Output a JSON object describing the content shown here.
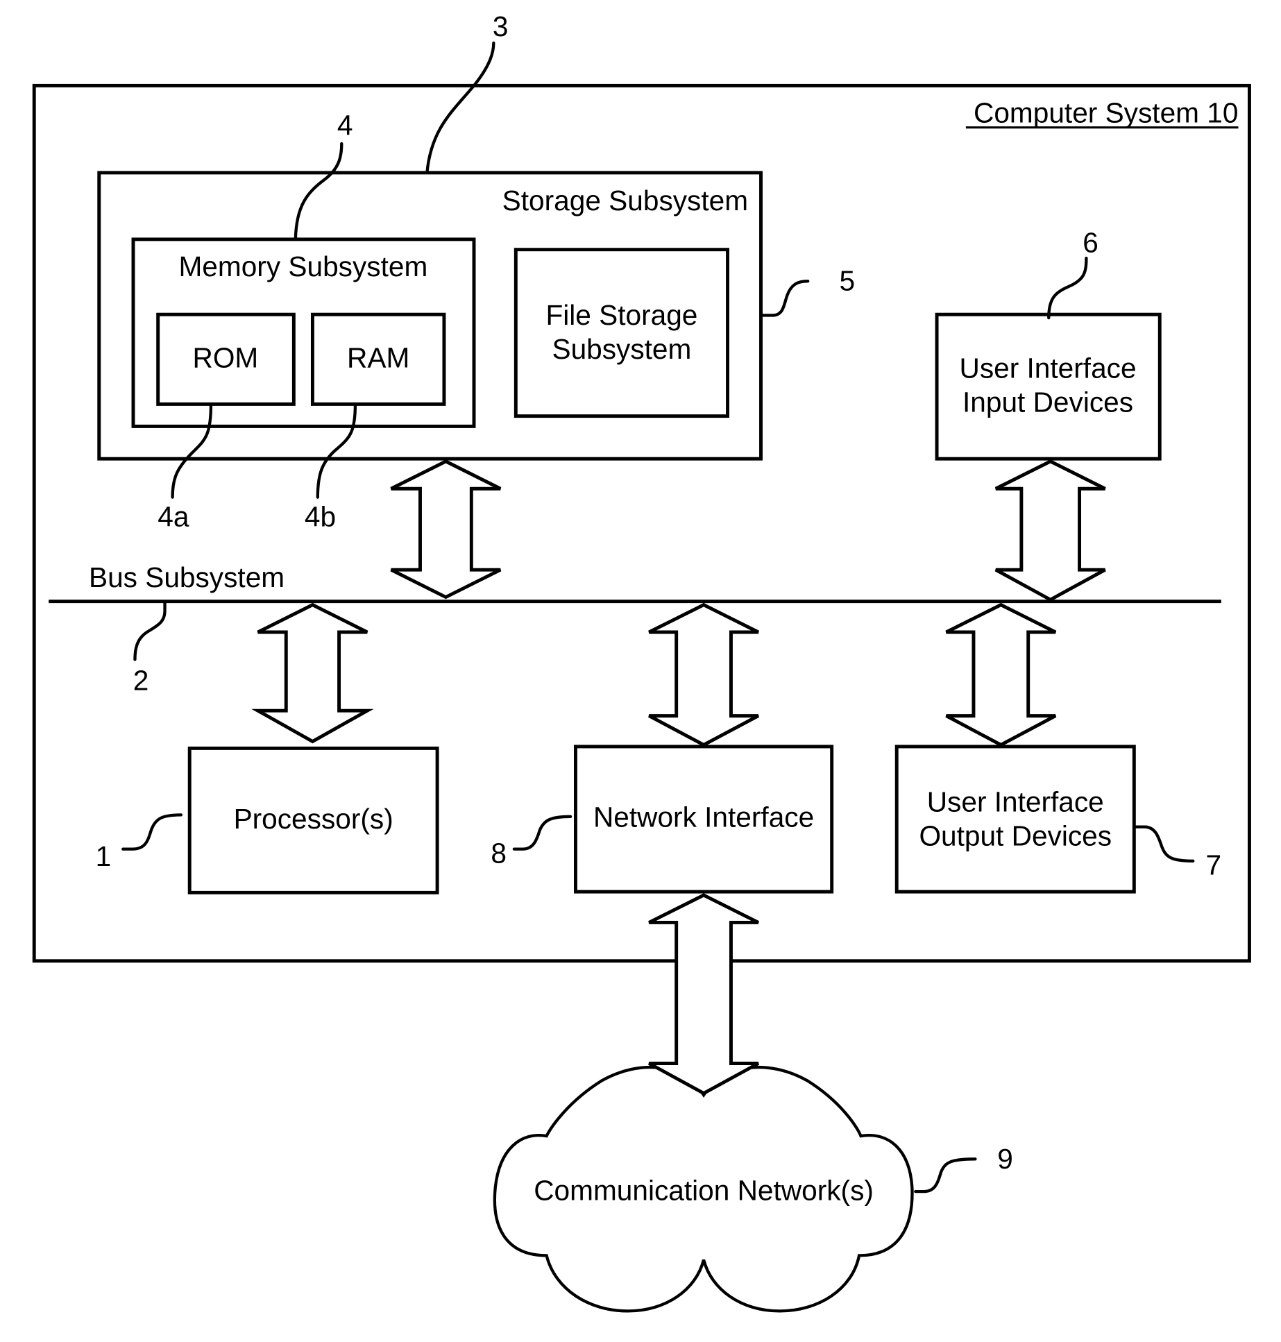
{
  "diagram": {
    "title": "Computer System 10",
    "components": {
      "storage_subsystem": {
        "label": "Storage Subsystem",
        "ref": "3"
      },
      "memory_subsystem": {
        "label": "Memory Subsystem",
        "ref": "4"
      },
      "rom": {
        "label": "ROM",
        "ref": "4a"
      },
      "ram": {
        "label": "RAM",
        "ref": "4b"
      },
      "file_storage": {
        "label_line1": "File Storage",
        "label_line2": "Subsystem",
        "ref": "5"
      },
      "ui_input": {
        "label_line1": "User Interface",
        "label_line2": "Input Devices",
        "ref": "6"
      },
      "bus": {
        "label": "Bus Subsystem",
        "ref": "2"
      },
      "processor": {
        "label": "Processor(s)",
        "ref": "1"
      },
      "network_interface": {
        "label": "Network Interface",
        "ref": "8"
      },
      "ui_output": {
        "label_line1": "User Interface",
        "label_line2": "Output Devices",
        "ref": "7"
      },
      "network": {
        "label": "Communication Network(s)",
        "ref": "9"
      }
    }
  }
}
